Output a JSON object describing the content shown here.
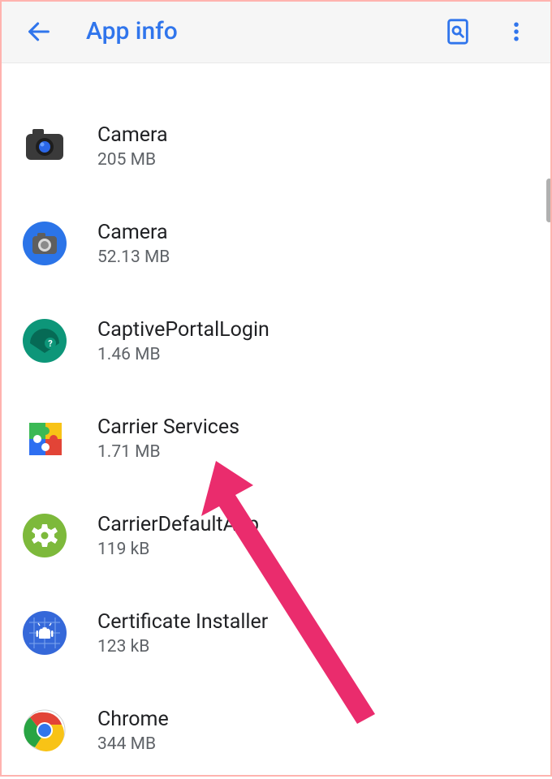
{
  "header": {
    "title": "App info"
  },
  "apps": [
    {
      "name": "Camera",
      "size": "205 MB",
      "icon": "camera-dark"
    },
    {
      "name": "Camera",
      "size": "52.13 MB",
      "icon": "camera-blue"
    },
    {
      "name": "CaptivePortalLogin",
      "size": "1.46 MB",
      "icon": "wifi-teal"
    },
    {
      "name": "Carrier Services",
      "size": "1.71 MB",
      "icon": "puzzle"
    },
    {
      "name": "CarrierDefaultApp",
      "size": "119 kB",
      "icon": "gear-green"
    },
    {
      "name": "Certificate Installer",
      "size": "123 kB",
      "icon": "android-blue"
    },
    {
      "name": "Chrome",
      "size": "344 MB",
      "icon": "chrome"
    }
  ]
}
